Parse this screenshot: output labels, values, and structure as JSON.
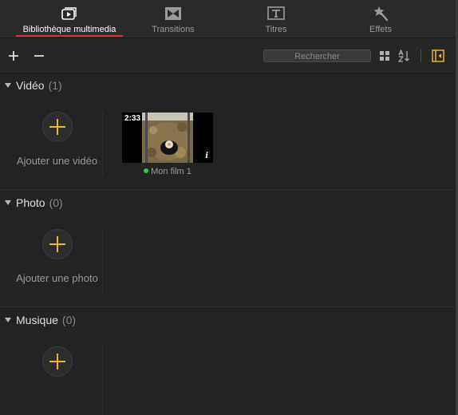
{
  "tabs": [
    {
      "label": "Bibliothèque multimedia",
      "icon": "media-library-icon",
      "active": true
    },
    {
      "label": "Transitions",
      "icon": "transitions-icon",
      "active": false
    },
    {
      "label": "Titres",
      "icon": "titles-icon",
      "active": false
    },
    {
      "label": "Effets",
      "icon": "effects-wand-icon",
      "active": false
    }
  ],
  "toolbar": {
    "add_icon": "plus-icon",
    "remove_icon": "minus-icon",
    "search_placeholder": "Rechercher",
    "grid_icon": "grid-view-icon",
    "sort_icon": "sort-az-icon",
    "sidebar_icon": "sidebar-toggle-icon"
  },
  "sections": {
    "video": {
      "title": "Vidéo",
      "count": "(1)",
      "add_label": "Ajouter une vidéo"
    },
    "photo": {
      "title": "Photo",
      "count": "(0)",
      "add_label": "Ajouter une photo"
    },
    "music": {
      "title": "Musique",
      "count": "(0)",
      "add_label": ""
    }
  },
  "clip": {
    "duration": "2:33",
    "info": "i",
    "name": "Mon film 1",
    "status_color": "#2ecc40"
  },
  "colors": {
    "accent_red": "#d8312f",
    "add_yellow": "#f0b429",
    "background": "#232323"
  }
}
